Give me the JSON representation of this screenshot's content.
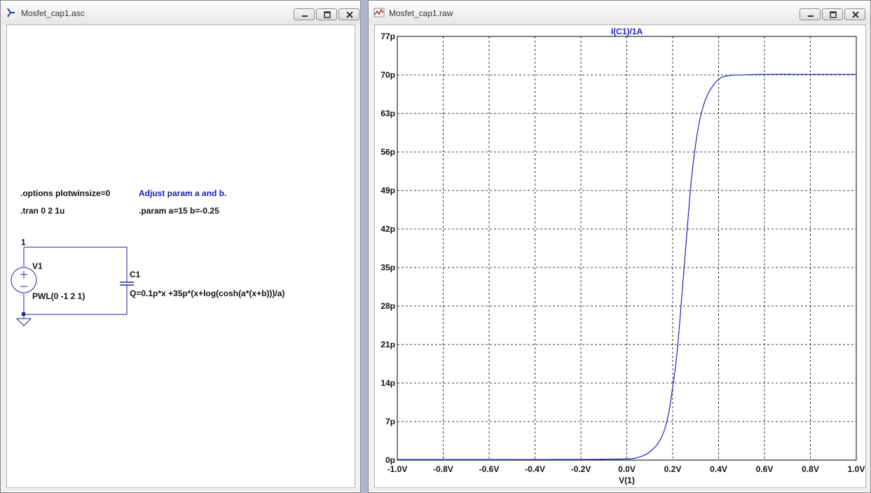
{
  "left_window": {
    "title": "Mosfet_cap1.asc",
    "icon": "ltspice-schematic-icon",
    "buttons": {
      "minimize": "minimize-icon",
      "restore": "restore-icon",
      "close": "close-icon"
    },
    "directives": {
      "options": ".options plotwinsize=0",
      "tran": ".tran 0 2 1u",
      "comment": "Adjust param a and b.",
      "param": ".param a=15 b=-0.25"
    },
    "components": {
      "node_label": "1",
      "source_name": "V1",
      "source_value": "PWL(0 -1 2 1)",
      "cap_name": "C1",
      "cap_value": "Q=0.1p*x +35p*(x+log(cosh(a*(x+b)))/a)"
    },
    "colors": {
      "wire": "#2020a0",
      "comment": "#1a1ab0"
    }
  },
  "right_window": {
    "title": "Mosfet_cap1.raw",
    "icon": "waveform-icon",
    "buttons": {
      "minimize": "minimize-icon",
      "restore": "restore-icon",
      "close": "close-icon"
    },
    "chart_data": {
      "type": "line",
      "title": "I(C1)/1A",
      "xlabel": "V(1)",
      "ylabel": "",
      "xlim": [
        -1.0,
        1.0
      ],
      "ylim": [
        0,
        77
      ],
      "x_ticks": [
        "-1.0V",
        "-0.8V",
        "-0.6V",
        "-0.4V",
        "-0.2V",
        "0.0V",
        "0.2V",
        "0.4V",
        "0.6V",
        "0.8V",
        "1.0V"
      ],
      "y_ticks": [
        "0p",
        "7p",
        "14p",
        "21p",
        "28p",
        "35p",
        "42p",
        "49p",
        "56p",
        "63p",
        "70p",
        "77p"
      ],
      "grid": true,
      "line_color": "#2020c0",
      "series": [
        {
          "x": [
            -1.0,
            -0.5,
            0.0,
            0.05,
            0.1,
            0.15,
            0.18,
            0.2,
            0.22,
            0.25,
            0.28,
            0.3,
            0.32,
            0.35,
            0.4,
            0.45,
            0.5,
            0.6,
            0.8,
            1.0
          ],
          "values": [
            0.1,
            0.1,
            0.2,
            0.5,
            1.5,
            4.0,
            8.0,
            13.3,
            20.0,
            35.1,
            50.3,
            57.4,
            62.2,
            66.2,
            69.2,
            69.9,
            70.0,
            70.1,
            70.1,
            70.1
          ]
        }
      ]
    }
  }
}
